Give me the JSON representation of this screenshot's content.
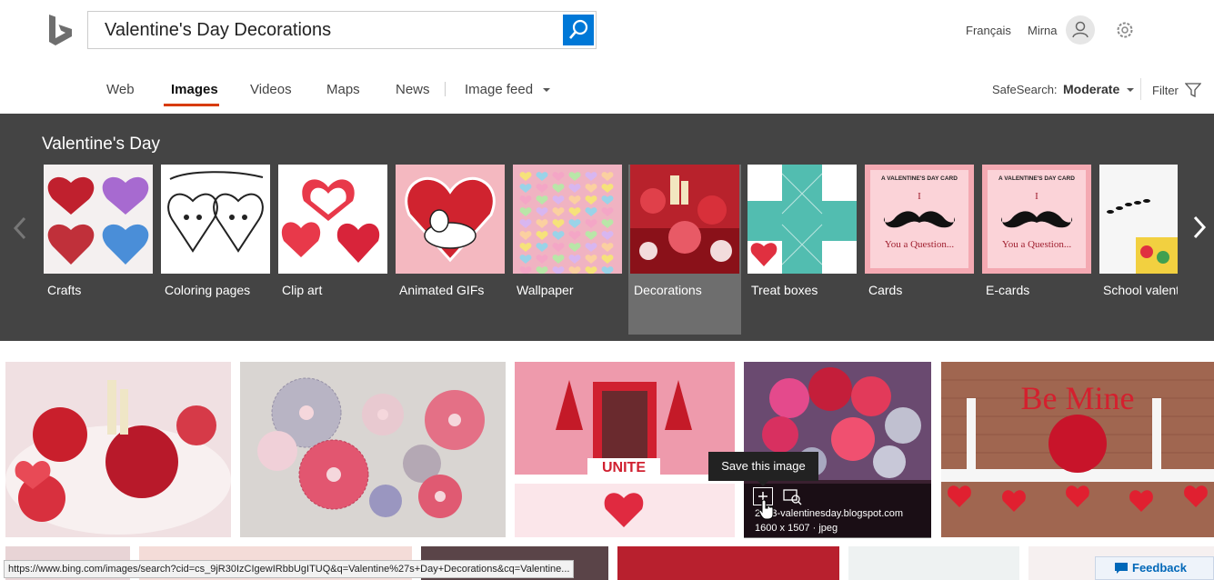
{
  "search": {
    "query": "Valentine's Day Decorations"
  },
  "header": {
    "language": "Français",
    "user": "Mirna"
  },
  "nav": {
    "web": "Web",
    "images": "Images",
    "videos": "Videos",
    "maps": "Maps",
    "news": "News",
    "image_feed": "Image feed"
  },
  "safesearch": {
    "label": "SafeSearch:",
    "value": "Moderate"
  },
  "filter": {
    "label": "Filter"
  },
  "carousel": {
    "title": "Valentine's Day",
    "items": [
      {
        "label": "Crafts"
      },
      {
        "label": "Coloring pages"
      },
      {
        "label": "Clip art"
      },
      {
        "label": "Animated GIFs"
      },
      {
        "label": "Wallpaper"
      },
      {
        "label": "Decorations"
      },
      {
        "label": "Treat boxes"
      },
      {
        "label": "Cards"
      },
      {
        "label": "E-cards"
      },
      {
        "label": "School valentines"
      }
    ],
    "card_text": {
      "title": "A VALENTINE'S DAY CARD",
      "line1": "I",
      "line2": "You a Question..."
    }
  },
  "results": {
    "tooltip": "Save this image",
    "hover_domain": "2013-valentinesday.blogspot.com",
    "hover_size": "1600 x 1507 · jpeg",
    "image_text": {
      "unite": "UNITE",
      "be_mine": "Be Mine"
    }
  },
  "status_url": "https://www.bing.com/images/search?cid=cs_9jR30IzCIgewIRbbUgITUQ&q=Valentine%27s+Day+Decorations&cq=Valentine...",
  "feedback": {
    "label": "Feedback"
  },
  "colors": {
    "accent": "#d83b01",
    "brand_blue": "#0078d7",
    "carousel_bg": "#444444"
  }
}
